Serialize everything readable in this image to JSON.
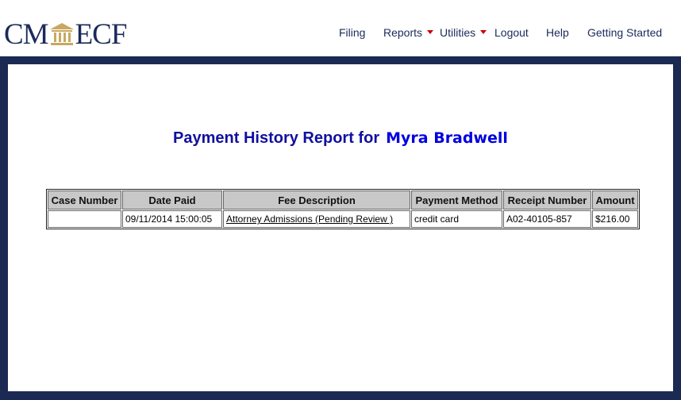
{
  "header": {
    "logo": {
      "left_text": "CM",
      "right_text": "ECF",
      "icon": "courthouse-icon"
    },
    "nav": [
      {
        "label": "Filing",
        "dropdown": false
      },
      {
        "label": "Reports",
        "dropdown": true
      },
      {
        "label": "Utilities",
        "dropdown": true
      },
      {
        "label": "Logout",
        "dropdown": false
      },
      {
        "label": "Help",
        "dropdown": false
      },
      {
        "label": "Getting Started",
        "dropdown": false
      }
    ]
  },
  "main": {
    "title": "Payment History Report for",
    "user_name": "Myra Bradwell",
    "table": {
      "columns": [
        "Case Number",
        "Date Paid",
        "Fee Description",
        "Payment Method",
        "Receipt Number",
        "Amount"
      ],
      "rows": [
        {
          "case_number": "",
          "date_paid": "09/11/2014 15:00:05",
          "fee_description": "Attorney Admissions (Pending Review )",
          "payment_method": "credit card",
          "receipt_number": "A02-40105-857",
          "amount": "$216.00"
        }
      ]
    }
  },
  "colors": {
    "navy": "#1b2a52",
    "title_blue": "#1010a0",
    "caret_red": "#cc0000",
    "header_gray": "#c8c8c8",
    "logo_gold": "#c8a860"
  }
}
